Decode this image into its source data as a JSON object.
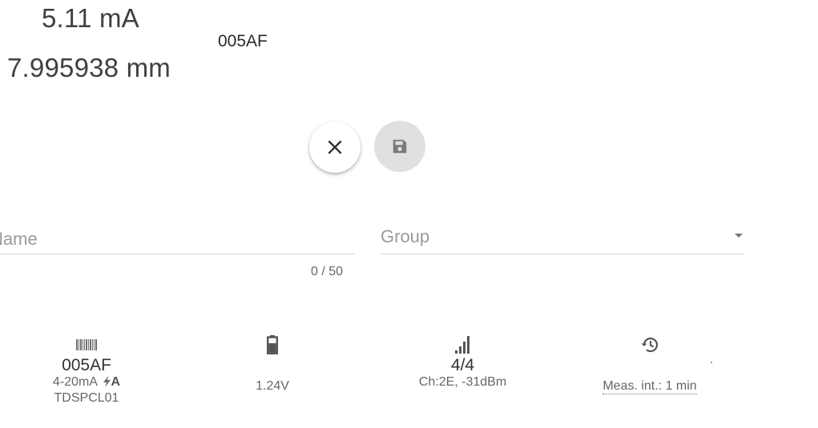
{
  "readings": {
    "current": "5.11 mA",
    "distance": "7.995938 mm",
    "device_id": "005AF"
  },
  "actions": {
    "close_icon": "close-icon",
    "save_icon": "floppy-disk-icon"
  },
  "form": {
    "name_label": "Name",
    "name_value": "",
    "name_counter": "0 / 50",
    "group_label": "Group",
    "group_value": ""
  },
  "details": {
    "device": {
      "icon": "barcode-icon",
      "id": "005AF",
      "type": "4-20mA",
      "type_badge": "A",
      "model": "TDSPCL01"
    },
    "battery": {
      "icon": "battery-icon",
      "voltage": "1.24V"
    },
    "signal": {
      "icon": "signal-bars-icon",
      "quality": "4/4",
      "channel": "Ch:2E, -31dBm"
    },
    "interval": {
      "icon": "history-icon",
      "label": "Meas. int.: 1 min"
    }
  },
  "colors": {
    "save_bg": "#e0e0e0",
    "icon_gray": "#6e6e6e"
  }
}
